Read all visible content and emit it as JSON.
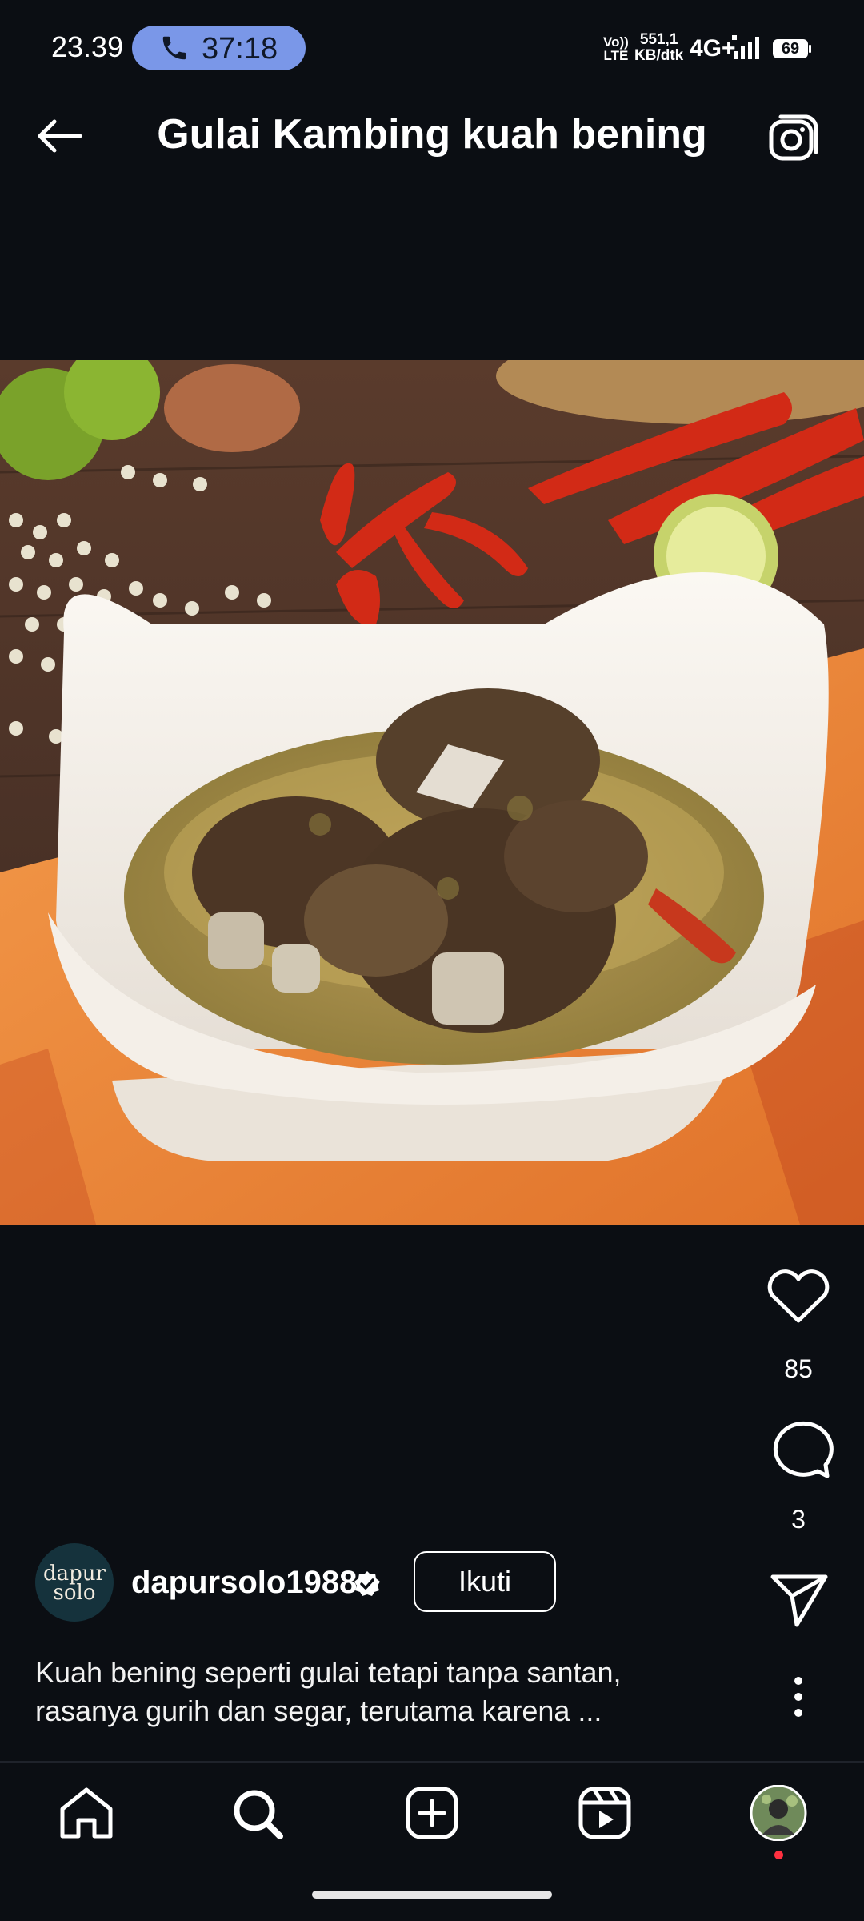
{
  "status_bar": {
    "time": "23.39",
    "call_duration": "37:18",
    "volte_line1": "Vo))",
    "volte_line2": "LTE",
    "speed_line1": "551,1",
    "speed_line2": "KB/dtk",
    "network": "4G+",
    "battery": "69"
  },
  "header": {
    "title": "Gulai Kambing kuah bening"
  },
  "post": {
    "likes": "85",
    "comments": "3",
    "author": {
      "username": "dapursolo1988",
      "avatar_line1": "dapur",
      "avatar_line2": "solo",
      "follow_label": "Ikuti"
    },
    "caption_line1": "Kuah bening seperti gulai tetapi tanpa santan,",
    "caption_line2": "rasanya gurih dan segar, terutama karena ..."
  },
  "colors": {
    "background": "#0b0e13",
    "call_pill": "#7a97e8",
    "notification_dot": "#ff3040"
  },
  "icons": [
    "back-arrow-icon",
    "camera-icon",
    "phone-icon",
    "heart-icon",
    "comment-icon",
    "share-icon",
    "more-icon",
    "home-icon",
    "search-icon",
    "create-icon",
    "reels-icon",
    "verified-icon"
  ]
}
